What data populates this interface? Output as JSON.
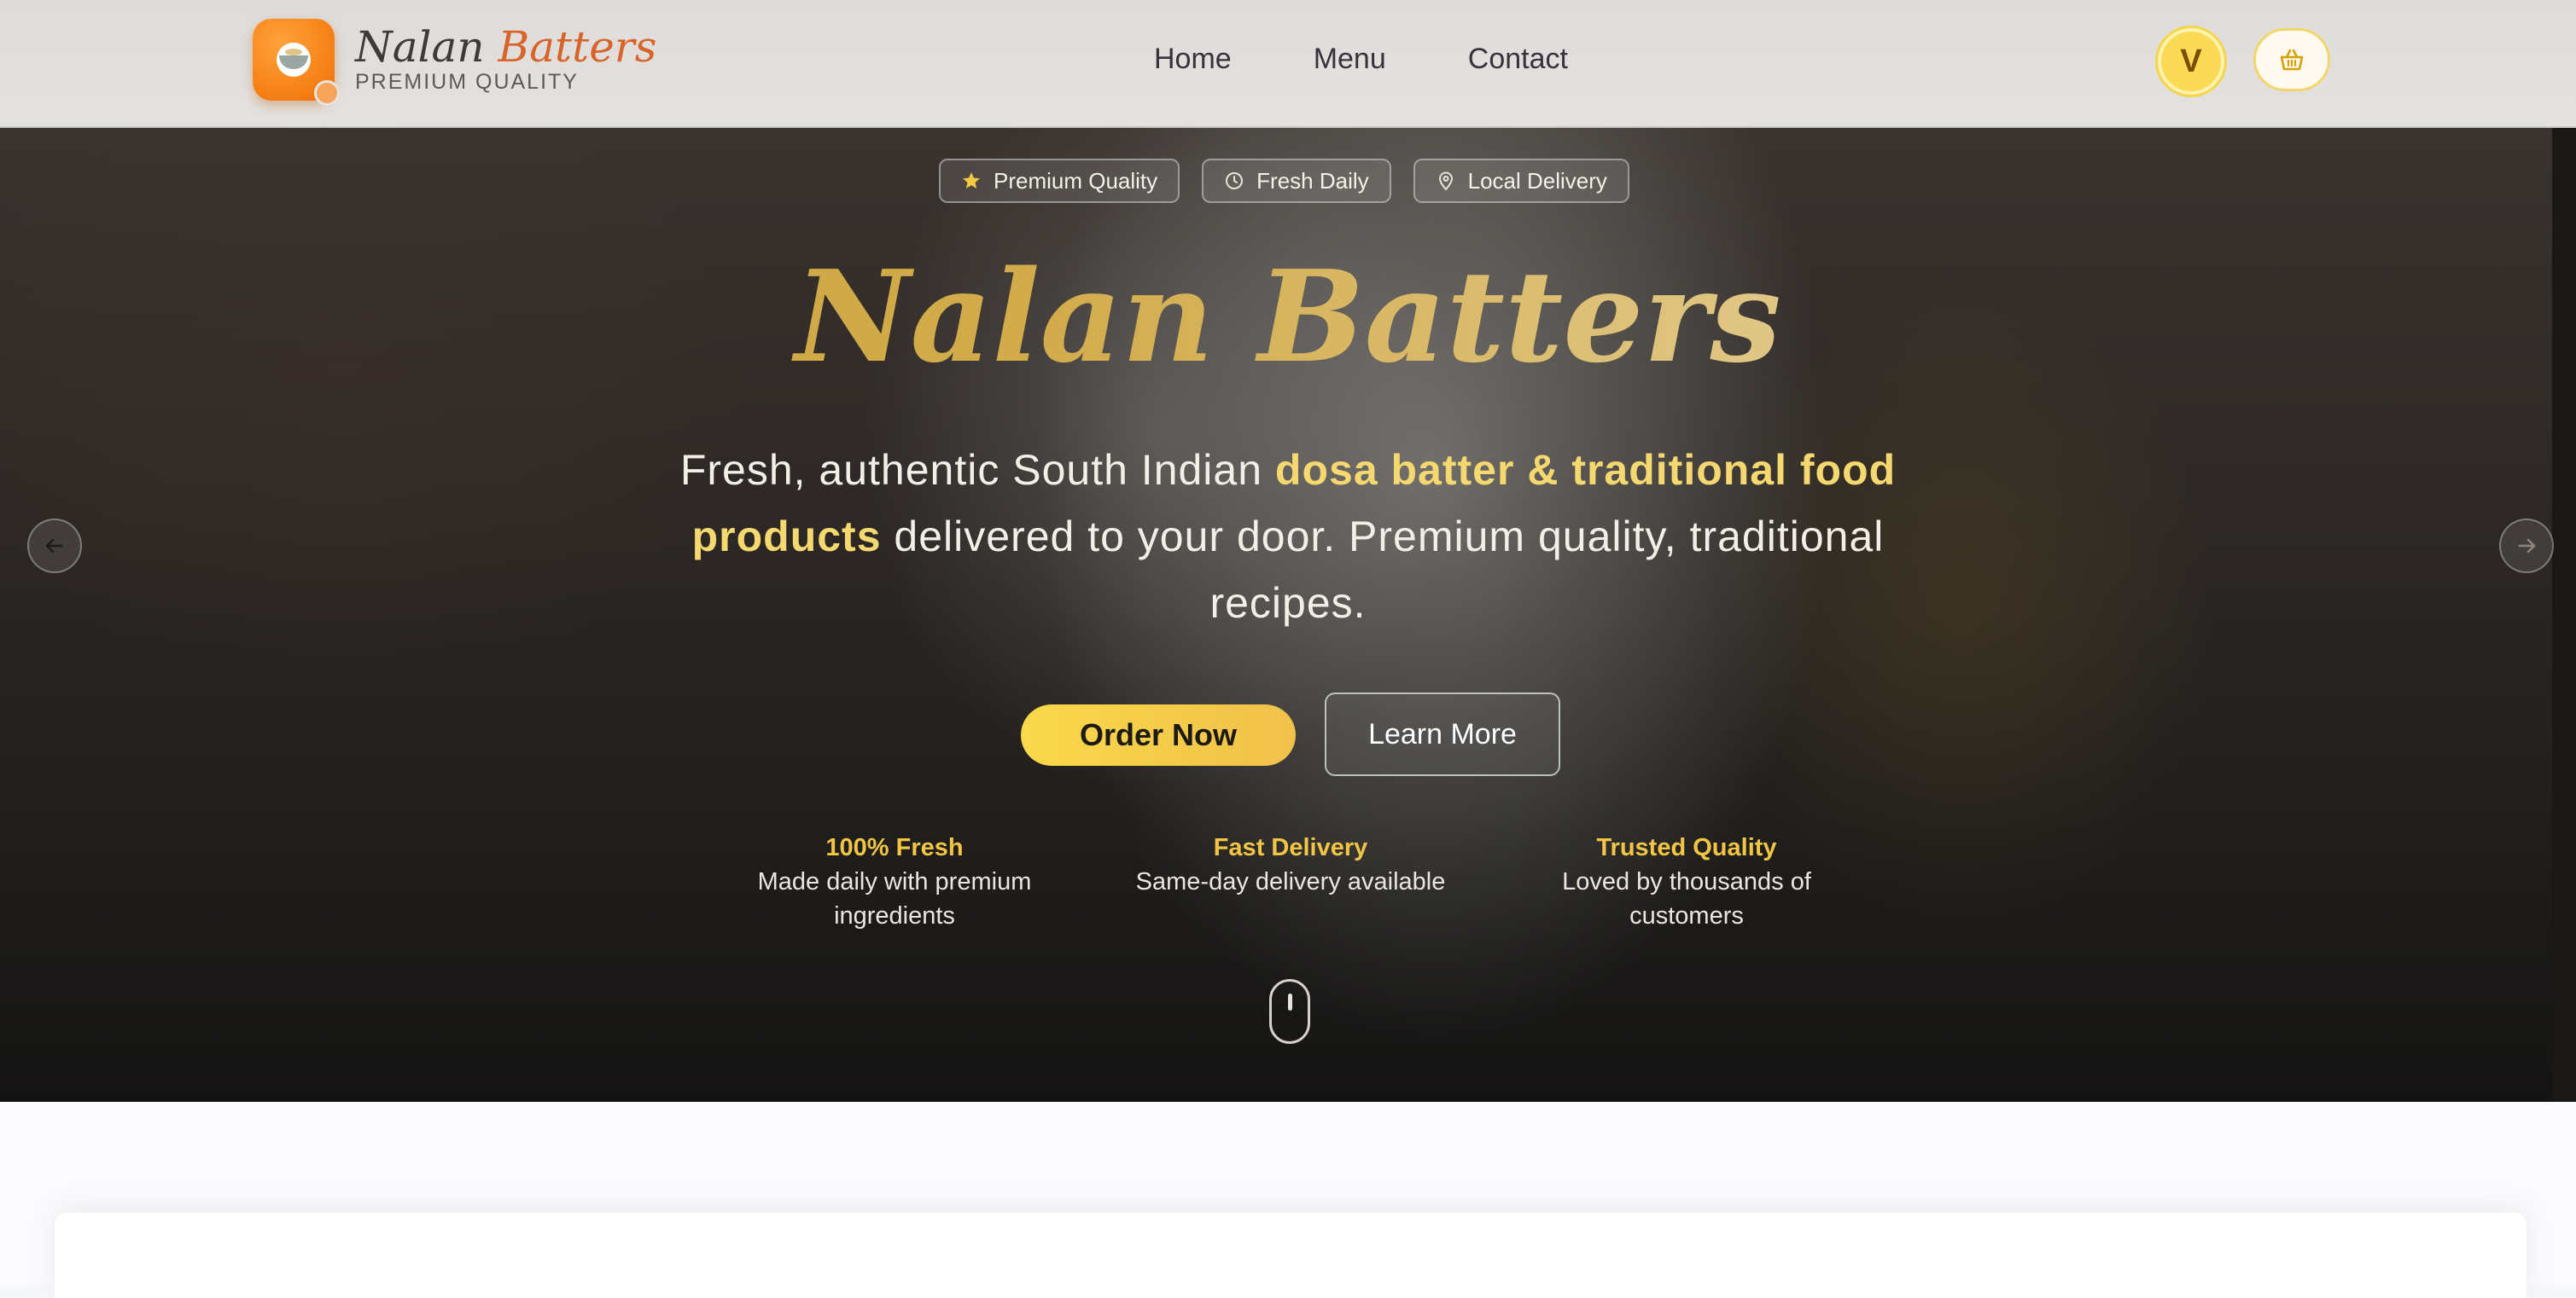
{
  "header": {
    "brand_first": "Nalan",
    "brand_second": "Batters",
    "brand_tagline": "PREMIUM QUALITY",
    "nav": [
      "Home",
      "Menu",
      "Contact"
    ],
    "avatar_initial": "V",
    "cart_icon": "basket-icon"
  },
  "hero": {
    "badges": [
      {
        "label": "Premium Quality",
        "icon": "star-icon"
      },
      {
        "label": "Fresh Daily",
        "icon": "clock-icon"
      },
      {
        "label": "Local Delivery",
        "icon": "location-pin-icon"
      }
    ],
    "title": "Nalan Batters",
    "description": {
      "part1": "Fresh, authentic South Indian ",
      "highlight": "dosa batter & traditional food products",
      "part2": " delivered to your door. Premium quality, traditional recipes."
    },
    "buttons": {
      "primary": "Order Now",
      "secondary": "Learn More"
    },
    "features": [
      {
        "title": "100% Fresh",
        "desc": "Made daily with premium ingredients"
      },
      {
        "title": "Fast Delivery",
        "desc": "Same-day delivery available"
      },
      {
        "title": "Trusted Quality",
        "desc": "Loved by thousands of customers"
      }
    ],
    "carousel": {
      "prev_icon": "arrow-left-icon",
      "next_icon": "arrow-right-icon"
    }
  },
  "colors": {
    "accent_gold": "#f2c644",
    "button_yellow": "#f9d84a",
    "brand_orange": "#f57f14",
    "hero_dark": "#332d2a"
  }
}
